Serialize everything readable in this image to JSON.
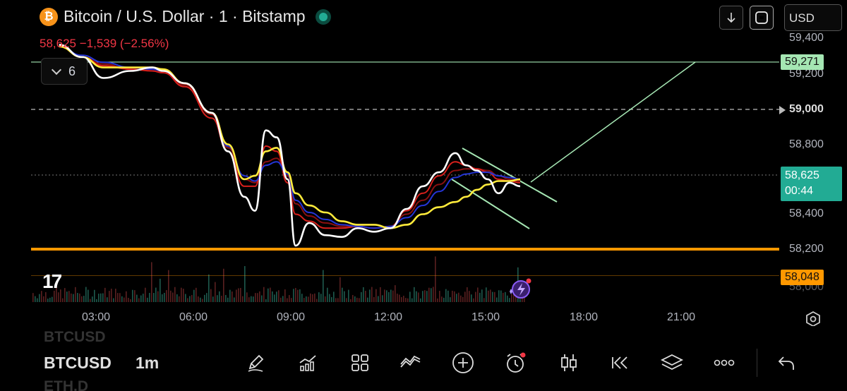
{
  "header": {
    "title": "Bitcoin / U.S. Dollar · 1 · Bitstamp",
    "logo_glyph": "₿",
    "price_change": "58,625 −1,539 (−2.56%)",
    "indicators_count": "6",
    "currency": "USD"
  },
  "price_axis": {
    "labels": [
      "59,400",
      "59,200",
      "59,000",
      "58,800",
      "58,400",
      "58,200",
      "58,000"
    ]
  },
  "price_tags": {
    "level_high": "59,271",
    "current_price": "58,625",
    "countdown": "00:44",
    "level_low": "58,048",
    "dashed_level": "59,000"
  },
  "time_axis": {
    "labels": [
      "03:00",
      "06:00",
      "09:00",
      "12:00",
      "15:00",
      "18:00",
      "21:00"
    ]
  },
  "bottom_bar": {
    "symbol": "BTCUSD",
    "symbol_above": "BTCUSD",
    "symbol_below": "ETH.D",
    "timeframe": "1m"
  },
  "icons": [
    "pencil-icon",
    "indicators-icon",
    "grid-icon",
    "trend-icon",
    "add-icon",
    "alert-icon",
    "candles-icon",
    "replay-icon",
    "layers-icon",
    "more-icon",
    "undo-icon"
  ],
  "colors": {
    "price_line": "#ffffff",
    "ma_yellow": "#ffeb3b",
    "ma_blue": "#2435d6",
    "ma_red": "#d8201c",
    "ma_darkred": "#8a1010",
    "support_orange": "#ff9800",
    "level_green": "#a5e6b3",
    "current_tag": "#22ab94",
    "negative": "#f23645"
  },
  "chart_data": {
    "type": "line",
    "title": "Bitcoin / U.S. Dollar · 1 · Bitstamp",
    "xlabel": "",
    "ylabel": "",
    "x_ticks": [
      "03:00",
      "06:00",
      "09:00",
      "12:00",
      "15:00",
      "18:00",
      "21:00"
    ],
    "ylim": [
      57940,
      59460
    ],
    "x": [
      "01:48",
      "02:30",
      "03:10",
      "04:00",
      "04:40",
      "05:00",
      "05:40",
      "06:30",
      "07:00",
      "07:30",
      "07:50",
      "08:10",
      "08:30",
      "08:50",
      "09:05",
      "09:30",
      "10:00",
      "10:30",
      "11:00",
      "11:30",
      "12:00",
      "12:30",
      "13:00",
      "13:30",
      "14:00",
      "14:20",
      "14:40",
      "15:00",
      "15:20",
      "15:40",
      "16:00"
    ],
    "series": [
      {
        "values": [
          59370,
          59300,
          59180,
          59220,
          59240,
          59220,
          59150,
          58980,
          58760,
          58500,
          58420,
          58880,
          58840,
          58600,
          58220,
          58350,
          58280,
          58270,
          58320,
          58300,
          58320,
          58430,
          58560,
          58640,
          58750,
          58680,
          58650,
          58600,
          58520,
          58580,
          58560
        ]
      },
      {
        "values": [
          59360,
          59300,
          59240,
          59240,
          59240,
          59230,
          59150,
          58980,
          58800,
          58600,
          58620,
          58760,
          58780,
          58640,
          58520,
          58450,
          58410,
          58360,
          58340,
          58340,
          58320,
          58340,
          58400,
          58440,
          58470,
          58500,
          58540,
          58570,
          58590,
          58590,
          58600
        ]
      },
      {
        "values": [
          59360,
          59300,
          59250,
          59230,
          59220,
          59210,
          59130,
          58950,
          58760,
          58560,
          58560,
          58790,
          58760,
          58580,
          58400,
          58360,
          58320,
          58320,
          58330,
          58320,
          58330,
          58420,
          58520,
          58620,
          58700,
          58680,
          58660,
          58640,
          58600,
          58590,
          58580
        ]
      },
      {
        "values": [
          59360,
          59300,
          59260,
          59230,
          59220,
          59210,
          59140,
          58970,
          58780,
          58600,
          58580,
          58700,
          58720,
          58620,
          58460,
          58390,
          58350,
          58330,
          58330,
          58320,
          58330,
          58400,
          58480,
          58570,
          58650,
          58660,
          58660,
          58650,
          58620,
          58600,
          58590
        ]
      },
      {
        "values": [
          59360,
          59310,
          59270,
          59240,
          59230,
          59220,
          59150,
          58980,
          58790,
          58620,
          58590,
          58680,
          58700,
          58630,
          58480,
          58410,
          58370,
          58340,
          58330,
          58320,
          58330,
          58380,
          58450,
          58530,
          58610,
          58630,
          58640,
          58640,
          58620,
          58610,
          58600
        ]
      }
    ],
    "horizontal_levels": [
      59271,
      59000,
      58200,
      58048
    ]
  }
}
